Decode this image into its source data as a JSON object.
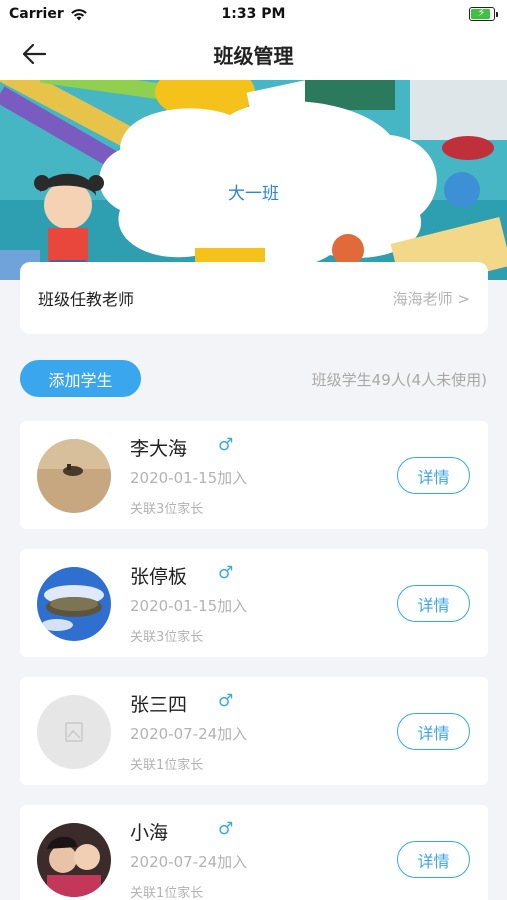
{
  "status_bar": {
    "carrier": "Carrier",
    "time": "1:33 PM"
  },
  "nav": {
    "title": "班级管理"
  },
  "banner": {
    "class_name": "大一班"
  },
  "teacher": {
    "label": "班级任教老师",
    "value": "海海老师 >"
  },
  "actions": {
    "add_student": "添加学生",
    "student_count": "班级学生49人(4人未使用)"
  },
  "students": [
    {
      "name": "李大海",
      "gender": "♂",
      "joined": "2020-01-15加入",
      "parents": "关联3位家长",
      "detail": "详情",
      "avatar": "desert-photo"
    },
    {
      "name": "张停板",
      "gender": "♂",
      "joined": "2020-01-15加入",
      "parents": "关联3位家长",
      "detail": "详情",
      "avatar": "sky-island-photo"
    },
    {
      "name": "张三四",
      "gender": "♂",
      "joined": "2020-07-24加入",
      "parents": "关联1位家长",
      "detail": "详情",
      "avatar": "placeholder-image"
    },
    {
      "name": "小海",
      "gender": "♂",
      "joined": "2020-07-24加入",
      "parents": "关联1位家长",
      "detail": "详情",
      "avatar": "children-photo"
    }
  ],
  "colors": {
    "accent": "#3aa6ee",
    "background": "#f3f4f8",
    "muted_text": "#b3b3b3"
  }
}
